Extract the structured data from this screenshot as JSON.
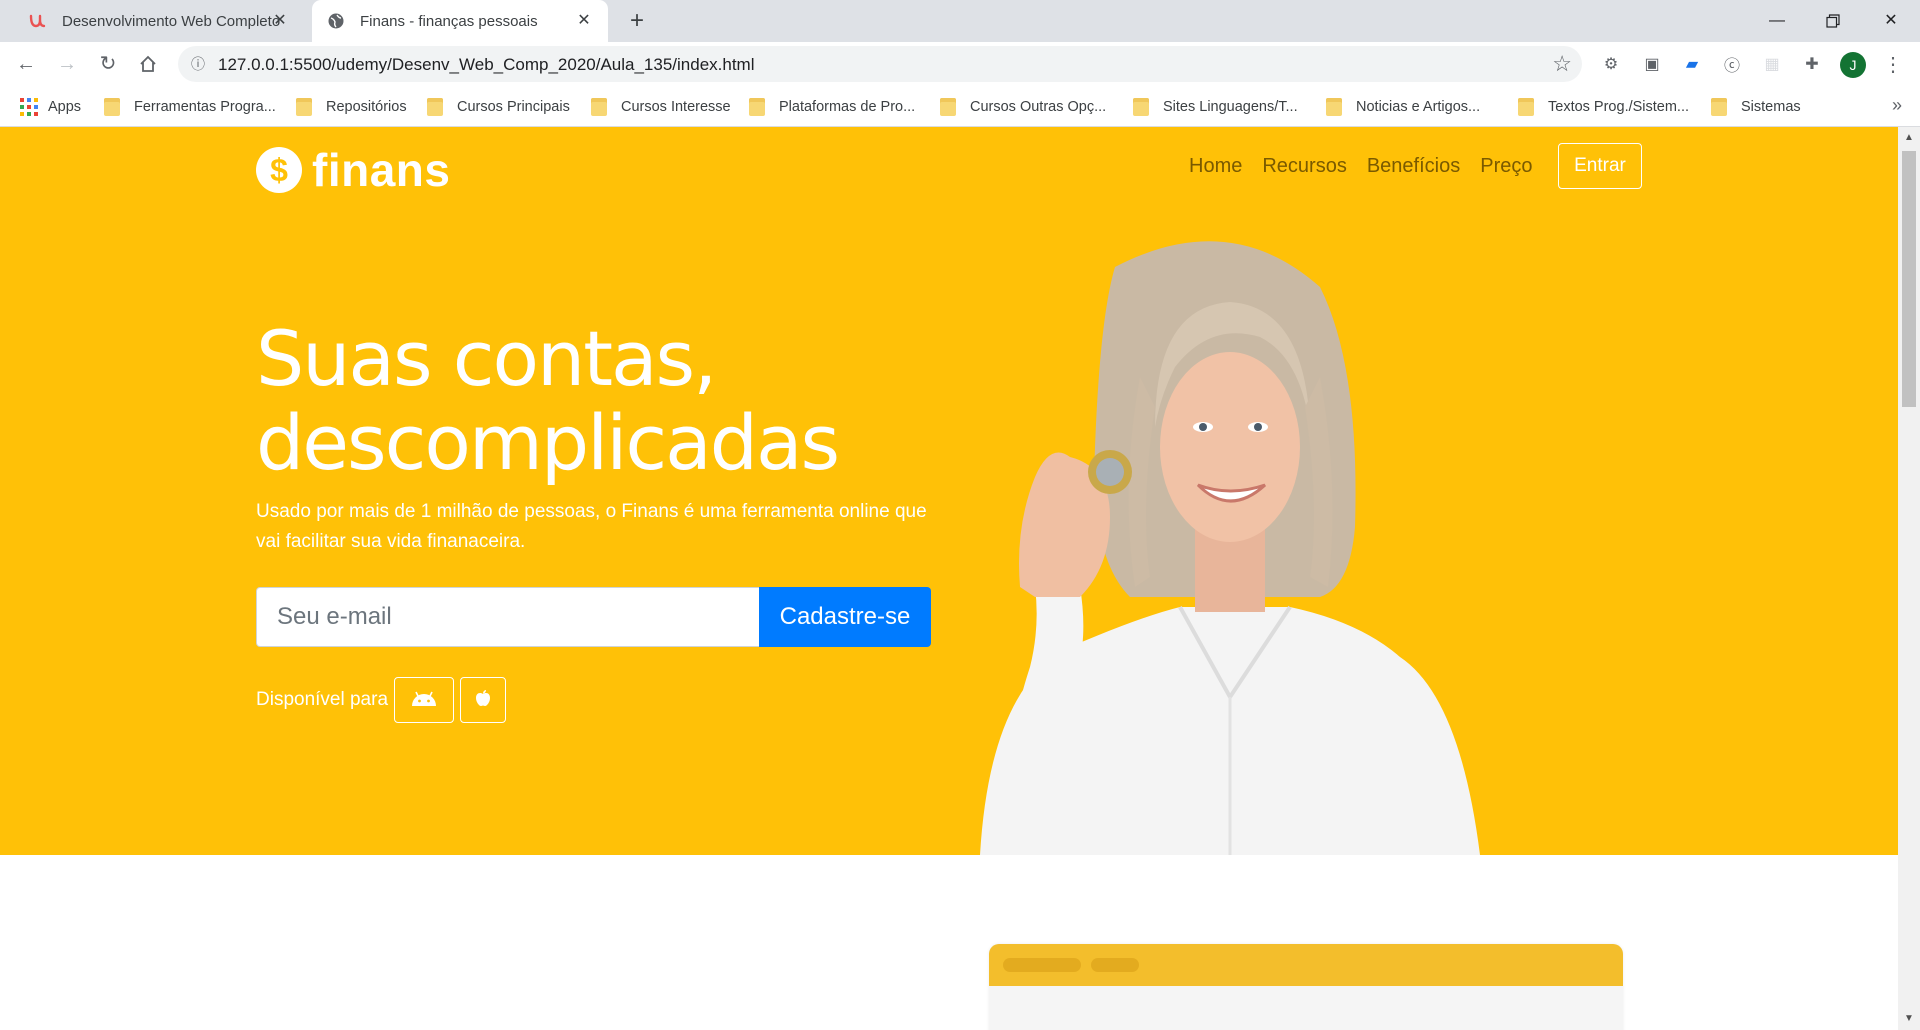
{
  "browser": {
    "tabs": [
      {
        "title": "Desenvolvimento Web Completo",
        "active": false
      },
      {
        "title": "Finans - finanças pessoais",
        "active": true
      }
    ],
    "url": "127.0.0.1:5500/udemy/Desenv_Web_Comp_2020/Aula_135/index.html",
    "avatar_letter": "J",
    "bookmarks": [
      {
        "label": "Apps",
        "icon": "apps-grid-icon"
      },
      {
        "label": "Ferramentas Progra...",
        "icon": "folder-icon"
      },
      {
        "label": "Repositórios",
        "icon": "folder-icon"
      },
      {
        "label": "Cursos Principais",
        "icon": "folder-icon"
      },
      {
        "label": "Cursos Interesse",
        "icon": "folder-icon"
      },
      {
        "label": "Plataformas de Pro...",
        "icon": "folder-icon"
      },
      {
        "label": "Cursos Outras Opç...",
        "icon": "folder-icon"
      },
      {
        "label": "Sites Linguagens/T...",
        "icon": "folder-icon"
      },
      {
        "label": "Noticias e Artigos...",
        "icon": "folder-icon"
      },
      {
        "label": "Textos Prog./Sistem...",
        "icon": "folder-icon"
      },
      {
        "label": "Sistemas",
        "icon": "folder-icon"
      }
    ]
  },
  "page": {
    "brand": {
      "symbol": "$",
      "name": "finans"
    },
    "nav": [
      {
        "label": "Home"
      },
      {
        "label": "Recursos"
      },
      {
        "label": "Benefícios"
      },
      {
        "label": "Preço"
      }
    ],
    "login_label": "Entrar",
    "headline_line1": "Suas contas,",
    "headline_line2": "descomplicadas",
    "lead": "Usado por mais de 1 milhão de pessoas, o Finans é uma ferramenta online que vai facilitar sua vida finanaceira.",
    "email_placeholder": "Seu e-mail",
    "signup_label": "Cadastre-se",
    "available_label": "Disponível para",
    "store_icons": [
      "android-icon",
      "apple-icon"
    ]
  },
  "colors": {
    "hero_bg": "#ffc107",
    "primary_button": "#007bff",
    "nav_text": "#7a5a00"
  }
}
